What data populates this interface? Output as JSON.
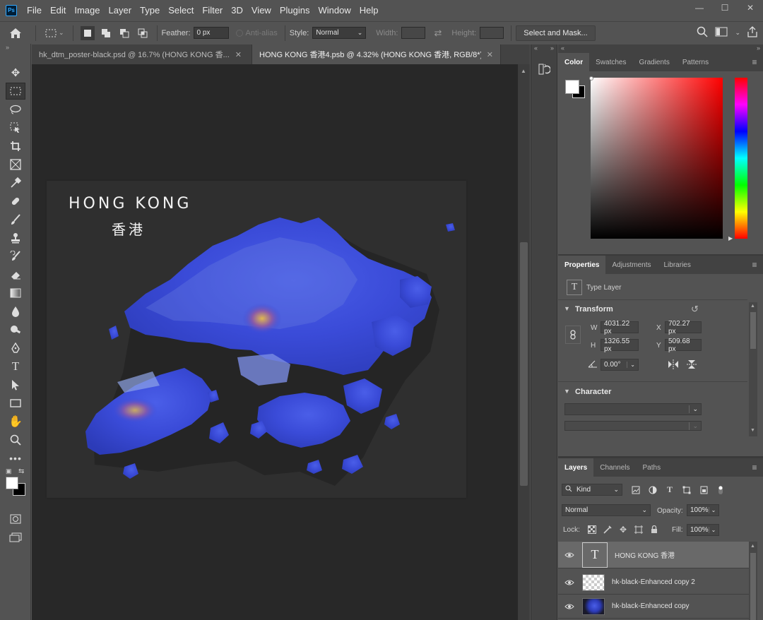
{
  "app": {
    "logo": "Ps"
  },
  "menu": [
    "File",
    "Edit",
    "Image",
    "Layer",
    "Type",
    "Select",
    "Filter",
    "3D",
    "View",
    "Plugins",
    "Window",
    "Help"
  ],
  "window_controls": {
    "minimize": "—",
    "maximize": "☐",
    "close": "✕"
  },
  "options": {
    "feather_label": "Feather:",
    "feather_value": "0 px",
    "antialias_label": "Anti-alias",
    "style_label": "Style:",
    "style_value": "Normal",
    "width_label": "Width:",
    "height_label": "Height:",
    "select_mask": "Select and Mask..."
  },
  "tabs": [
    {
      "label": "hk_dtm_poster-black.psd @ 16.7% (HONG KONG 香...",
      "close": "✕"
    },
    {
      "label": "HONG KONG 香港4.psb @ 4.32% (HONG KONG 香港, RGB/8*)",
      "close": "✕"
    }
  ],
  "poster": {
    "title": "HONG KONG",
    "subtitle": "香港"
  },
  "color_panel": {
    "tabs": [
      "Color",
      "Swatches",
      "Gradients",
      "Patterns"
    ],
    "menu": "≡",
    "fg": "#ffffff",
    "bg": "#000000"
  },
  "properties_panel": {
    "tabs": [
      "Properties",
      "Adjustments",
      "Libraries"
    ],
    "menu": "≡",
    "type_label": "Type Layer",
    "type_icon": "T",
    "transform_label": "Transform",
    "reset": "↺",
    "w_label": "W",
    "w_value": "4031.22 px",
    "h_label": "H",
    "h_value": "1326.55 px",
    "x_label": "X",
    "x_value": "702.27 px",
    "y_label": "Y",
    "y_value": "509.68 px",
    "angle_value": "0.00°",
    "character_label": "Character"
  },
  "layers_panel": {
    "tabs": [
      "Layers",
      "Channels",
      "Paths"
    ],
    "menu": "≡",
    "filter_kind": "Kind",
    "blend_mode": "Normal",
    "opacity_label": "Opacity:",
    "opacity_value": "100%",
    "lock_label": "Lock:",
    "fill_label": "Fill:",
    "fill_value": "100%",
    "layers": [
      {
        "name": "HONG KONG 香港",
        "thumb": "T"
      },
      {
        "name": "hk-black-Enhanced copy 2",
        "thumb": ""
      },
      {
        "name": "hk-black-Enhanced copy",
        "thumb": ""
      }
    ]
  },
  "colors": {
    "accent": "#31a8ff",
    "map_blue": "#3c52d9",
    "map_light": "#8fa4e6",
    "peak": "#c9a24e"
  }
}
